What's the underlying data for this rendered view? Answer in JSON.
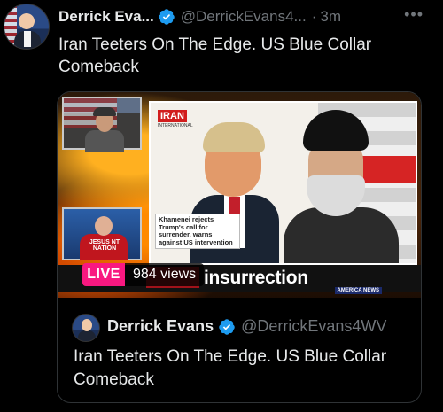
{
  "post": {
    "author_name": "Derrick Eva...",
    "handle": "@DerrickEvans4...",
    "separator": "·",
    "time": "3m",
    "more": "•••",
    "text": "Iran Teeters On The Edge. US Blue Collar Comeback"
  },
  "media": {
    "channel_logo": "IRAN",
    "channel_sub": "INTERNATIONAL",
    "caption": "Khamenei rejects Trump's call for surrender, warns against US intervention",
    "ticker": "insurrection",
    "network_tag": "AMERICA NEWS",
    "shirt_text": "JESUS NT NATION",
    "live_label": "LIVE",
    "views": "984 views"
  },
  "quoted": {
    "author_name": "Derrick Evans",
    "handle": "@DerrickEvans4WV",
    "text": "Iran Teeters On The Edge. US Blue Collar Comeback"
  },
  "colors": {
    "background": "#000000",
    "verified": "#1d9bf0",
    "live": "#f91880",
    "muted": "#71767b"
  },
  "icons": [
    "verified-badge-icon",
    "more-options-icon"
  ]
}
